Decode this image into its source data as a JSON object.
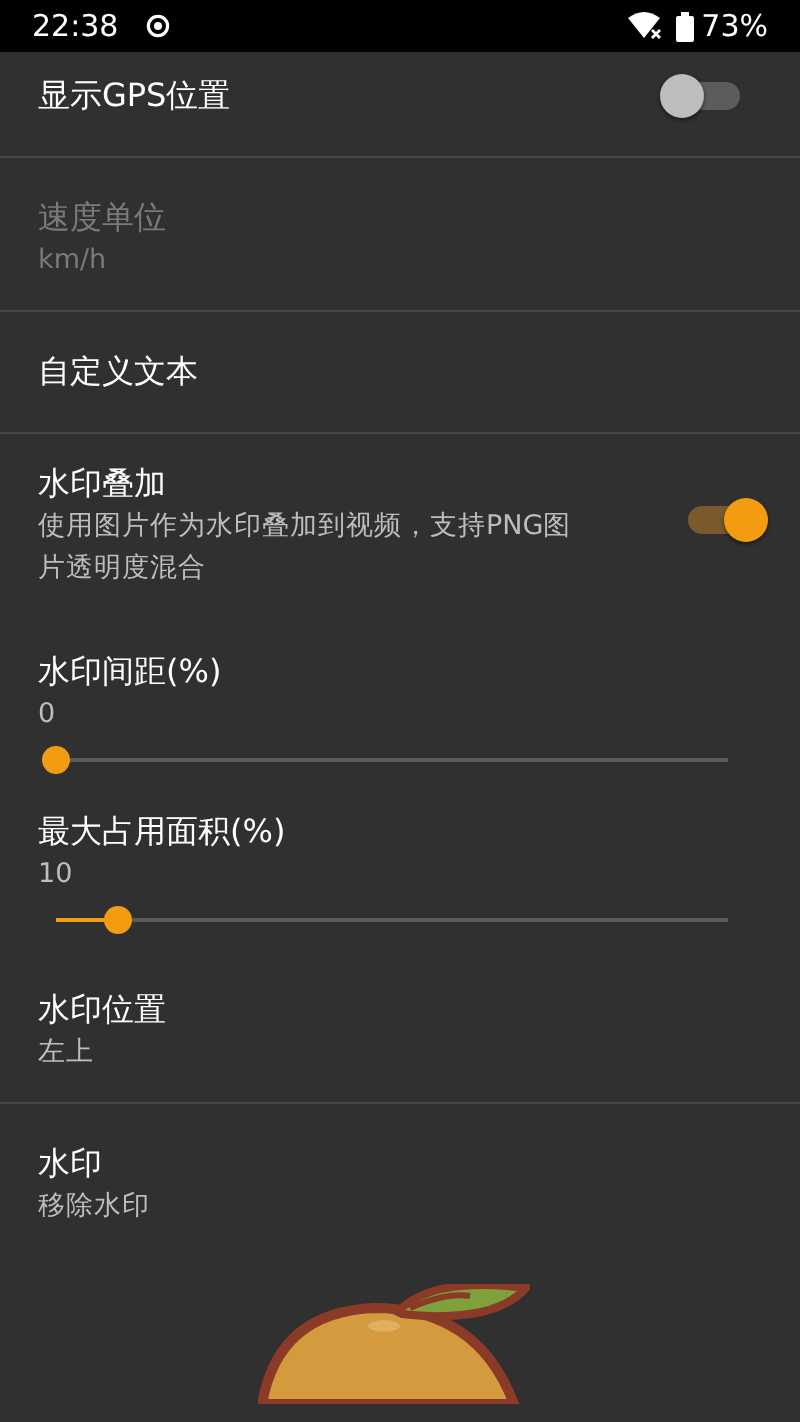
{
  "status_bar": {
    "time": "22:38",
    "battery": "73%"
  },
  "sections": [
    {
      "items": [
        {
          "kind": "switch",
          "title": "显示GPS位置",
          "on": false
        }
      ]
    },
    {
      "items": [
        {
          "kind": "text",
          "title": "速度单位",
          "summary": "km/h",
          "disabled": true
        }
      ]
    },
    {
      "items": [
        {
          "kind": "text",
          "title": "自定义文本",
          "disabled": false
        }
      ]
    },
    {
      "items": [
        {
          "kind": "switch",
          "title": "水印叠加",
          "summary": "使用图片作为水印叠加到视频，支持PNG图片透明度混合",
          "on": true
        },
        {
          "kind": "slider",
          "title": "水印间距(%)",
          "value": "0",
          "level": 0
        },
        {
          "kind": "slider",
          "title": "最大占用面积(%)",
          "value": "10",
          "level": 0.093
        },
        {
          "kind": "text",
          "title": "水印位置",
          "summary": "左上",
          "disabled": false
        }
      ]
    },
    {
      "items": [
        {
          "kind": "text",
          "title": "水印",
          "summary": "移除水印",
          "disabled": false
        }
      ]
    }
  ]
}
